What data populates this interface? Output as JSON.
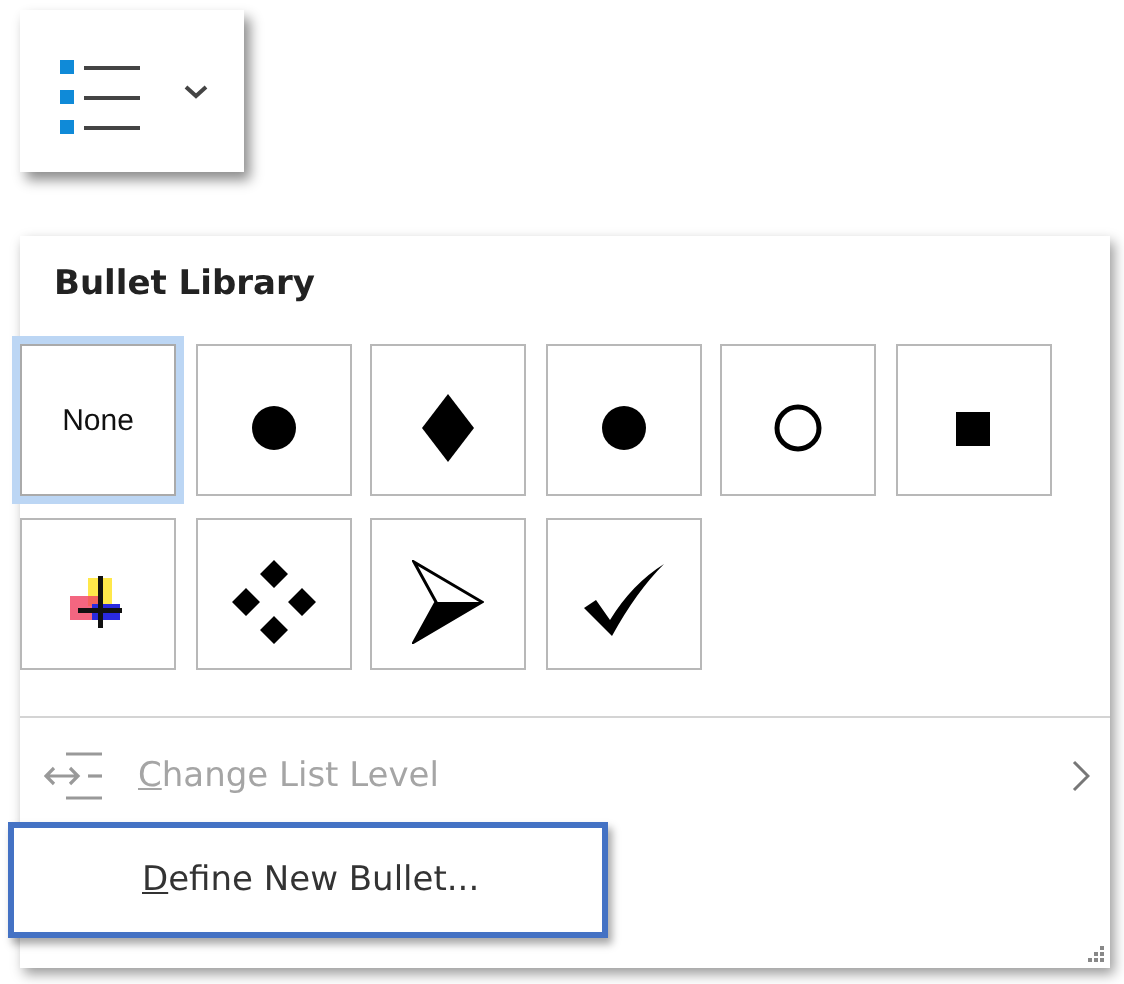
{
  "heading": "Bullet Library",
  "bullets": [
    {
      "kind": "none",
      "label": "None",
      "selected": true
    },
    {
      "kind": "dot",
      "selected": false
    },
    {
      "kind": "diamond",
      "selected": false
    },
    {
      "kind": "dot",
      "selected": false
    },
    {
      "kind": "circle",
      "selected": false
    },
    {
      "kind": "square",
      "selected": false
    },
    {
      "kind": "picture",
      "selected": false
    },
    {
      "kind": "four-diamonds",
      "selected": false
    },
    {
      "kind": "arrowhead",
      "selected": false
    },
    {
      "kind": "check",
      "selected": false
    }
  ],
  "menu_items": [
    {
      "label": "Change List Level",
      "disabled": true,
      "highlighted": false,
      "submenu": true
    },
    {
      "label": "Define New Bullet...",
      "disabled": false,
      "highlighted": true,
      "submenu": false
    }
  ]
}
